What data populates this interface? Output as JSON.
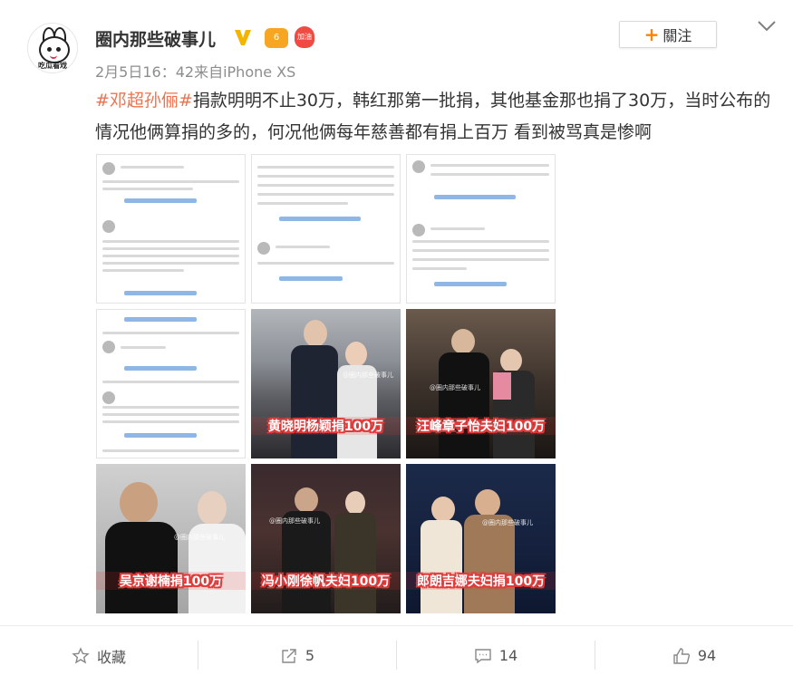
{
  "post": {
    "username": "圈内那些破事儿",
    "avatar_caption": "吃瓜看戏",
    "crown_badge": "6",
    "jia_badge": "加油",
    "meta": "2月5日16：42来自iPhone XS",
    "follow_label": "關注",
    "hashtag": "#邓超孙俪#",
    "body_text": "捐款明明不止30万，韩红那第一批捐，其他基金那也捐了30万，当时公布的情况他俩算捐的多的，何况他俩每年慈善都有捐上百万 看到被骂真是惨啊"
  },
  "images": [
    {
      "kind": "screenshot"
    },
    {
      "kind": "screenshot"
    },
    {
      "kind": "screenshot"
    },
    {
      "kind": "screenshot"
    },
    {
      "kind": "photo",
      "caption": "黄晓明杨颖捐100万",
      "watermark": "@圈内那些破事儿"
    },
    {
      "kind": "photo",
      "caption": "汪峰章子怡夫妇100万",
      "watermark": "@圈内那些破事儿"
    },
    {
      "kind": "photo",
      "caption": "吴京谢楠捐100万",
      "watermark": "@圈内那些破事儿"
    },
    {
      "kind": "photo",
      "caption": "冯小刚徐帆夫妇100万",
      "watermark": "@圈内那些破事儿"
    },
    {
      "kind": "photo",
      "caption": "郎朗吉娜夫妇捐100万",
      "watermark": "@圈内那些破事儿"
    }
  ],
  "toolbar": {
    "favorite_label": "收藏",
    "repost_count": "5",
    "comment_count": "14",
    "like_count": "94"
  },
  "colors": {
    "hashtag": "#eb7350",
    "follow_plus": "#ff8200",
    "caption_stroke": "#e23a3a"
  }
}
